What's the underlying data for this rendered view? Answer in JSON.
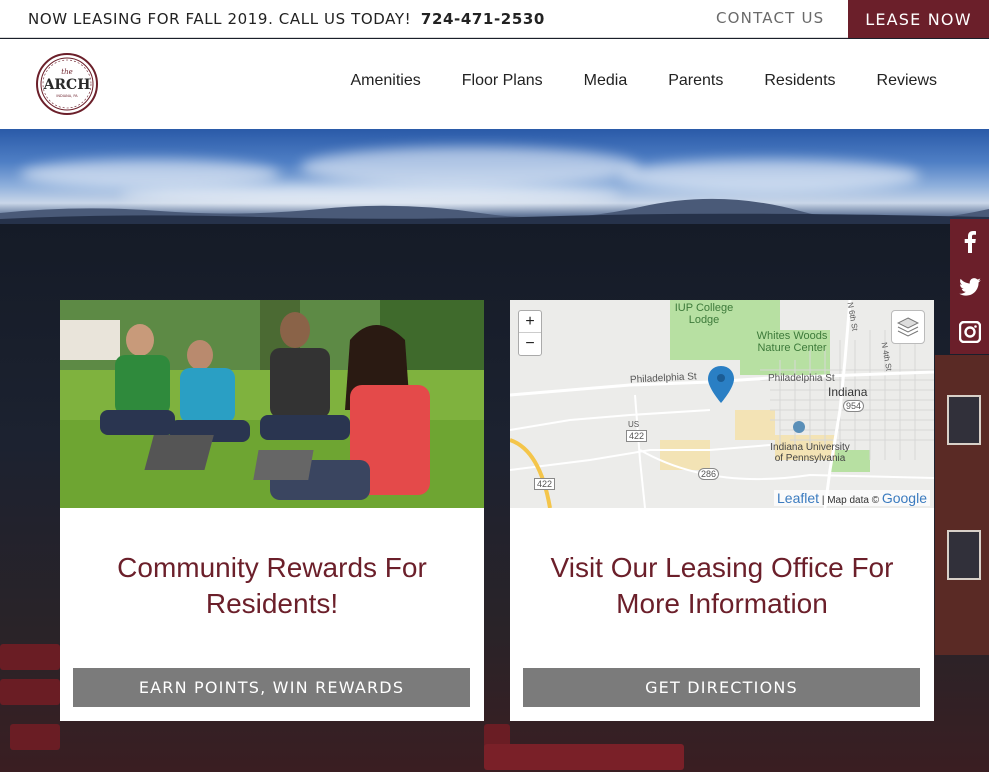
{
  "topbar": {
    "promo_text": "NOW LEASING FOR FALL 2019. CALL US TODAY!",
    "phone": "724-471-2530",
    "contact_label": "CONTACT US",
    "lease_label": "LEASE NOW"
  },
  "logo": {
    "small_word": "the",
    "name": "ARCH",
    "location": "INDIANA, PA"
  },
  "nav": {
    "items": [
      "Amenities",
      "Floor Plans",
      "Media",
      "Parents",
      "Residents",
      "Reviews"
    ]
  },
  "social": {
    "icons": [
      "facebook-icon",
      "twitter-icon",
      "instagram-icon"
    ],
    "color": "#6b1f2a"
  },
  "cards": [
    {
      "title": "Community Rewards For Residents!",
      "button_label": "EARN POINTS, WIN REWARDS"
    },
    {
      "title": "Visit Our Leasing Office For More Information",
      "button_label": "GET DIRECTIONS"
    }
  ],
  "map": {
    "zoom_in": "+",
    "zoom_out": "−",
    "labels": {
      "iup_lodge": "IUP College Lodge",
      "whites_woods": "Whites Woods Nature Center",
      "philadelphia_st_left": "Philadelphia St",
      "philadelphia_st_right": "Philadelphia St",
      "indiana": "Indiana",
      "iup": "Indiana University of Pennsylvania",
      "route_954": "954",
      "route_286": "286",
      "route_422a": "422",
      "route_422b": "422",
      "route_us": "US",
      "n_6th_st": "N 6th St",
      "n_4th_st": "N 4th St"
    },
    "attribution_leaflet": "Leaflet",
    "attribution_text": "| Map data ©",
    "attribution_google": "Google"
  },
  "colors": {
    "brand": "#6b1f2a",
    "button_gray": "#7b7b7b"
  }
}
